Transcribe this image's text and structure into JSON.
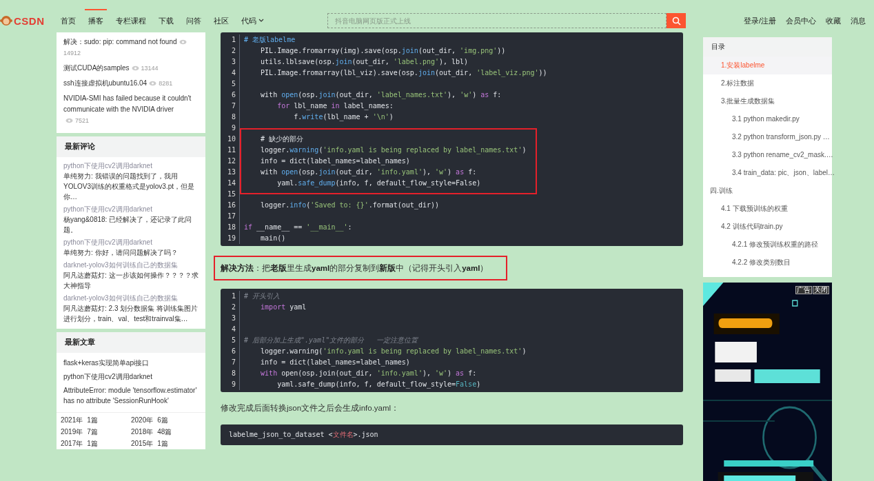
{
  "nav": {
    "logo": "CSDN",
    "items": [
      {
        "label": "首页",
        "selected": false,
        "has_menu": false
      },
      {
        "label": "播客",
        "selected": true,
        "has_menu": false
      },
      {
        "label": "专栏课程",
        "selected": false,
        "has_menu": false
      },
      {
        "label": "下载",
        "selected": false,
        "has_menu": false
      },
      {
        "label": "问答",
        "selected": false,
        "has_menu": false
      },
      {
        "label": "社区",
        "selected": false,
        "has_menu": false
      },
      {
        "label": "代码",
        "selected": false,
        "has_menu": true
      }
    ],
    "search": {
      "placeholder": "抖音电脑网页版正式上线"
    },
    "links": [
      "登录/注册",
      "会员中心",
      "收藏",
      "消息"
    ]
  },
  "sidebar": {
    "popular": [
      {
        "title": "解决：sudo: pip: command not found",
        "views": "14912"
      },
      {
        "title": "测试CUDA的samples",
        "views": "13144"
      },
      {
        "title": "ssh连接虚拟机ubuntu16.04",
        "views": "8281"
      },
      {
        "title": "NVIDIA-SMI has failed because it couldn't communicate with the NVIDIA driver",
        "views": "7521"
      }
    ],
    "comments": {
      "title": "最新评论",
      "items": [
        {
          "article": "python下使用cv2调用darknet",
          "text": "单纯努力: 我错误的问题找到了，我用YOLOV3训练的权重格式是yolov3.pt，但是你…"
        },
        {
          "article": "python下使用cv2调用darknet",
          "text": "杨yang&0818: 已经解决了，还记录了此问题。"
        },
        {
          "article": "python下使用cv2调用darknet",
          "text": "单纯努力: 你好，请问问题解决了吗？"
        },
        {
          "article": "darknet-yolov3如何训练自己的数据集",
          "text": "阿凡达蘑菇灯: 这一步该如何操作？？？？求大神指导"
        },
        {
          "article": "darknet-yolov3如何训练自己的数据集",
          "text": "阿凡达蘑菇灯: 2.3 划分数据集 将训练集图片进行划分，train、val、test和trainval集…"
        }
      ]
    },
    "articles": {
      "title": "最新文章",
      "items": [
        "flask+keras实现简单api接口",
        "python下使用cv2调用darknet",
        "AttributeError: module 'tensorflow.estimator' has no attribute 'SessionRunHook'"
      ],
      "archive": [
        {
          "year": "2021年",
          "count": "1篇"
        },
        {
          "year": "2020年",
          "count": "6篇"
        },
        {
          "year": "2019年",
          "count": "7篇"
        },
        {
          "year": "2018年",
          "count": "48篇"
        },
        {
          "year": "2017年",
          "count": "1篇"
        },
        {
          "year": "2015年",
          "count": "1篇"
        }
      ]
    }
  },
  "content": [
    {
      "kind": "code",
      "numbered": true,
      "segments": [
        {
          "boxed": false,
          "lines": [
            {
              "n": "1",
              "tokens": [
                {
                  "kind": "heading",
                  "t": "# 老版labelme"
                }
              ]
            },
            {
              "n": "2",
              "tokens": [
                {
                  "kind": "plain",
                  "t": "    PIL.Image.fromarray(img).save(osp."
                },
                {
                  "kind": "fn",
                  "t": "join"
                },
                {
                  "kind": "plain",
                  "t": "(out_dir, "
                },
                {
                  "kind": "str",
                  "t": "'img.png'"
                },
                {
                  "kind": "plain",
                  "t": "))"
                }
              ]
            },
            {
              "n": "3",
              "tokens": [
                {
                  "kind": "plain",
                  "t": "    utils.lblsave(osp."
                },
                {
                  "kind": "fn",
                  "t": "join"
                },
                {
                  "kind": "plain",
                  "t": "(out_dir, "
                },
                {
                  "kind": "str",
                  "t": "'label.png'"
                },
                {
                  "kind": "plain",
                  "t": "), lbl)"
                }
              ]
            },
            {
              "n": "4",
              "tokens": [
                {
                  "kind": "plain",
                  "t": "    PIL.Image.fromarray(lbl_viz).save(osp."
                },
                {
                  "kind": "fn",
                  "t": "join"
                },
                {
                  "kind": "plain",
                  "t": "(out_dir, "
                },
                {
                  "kind": "str",
                  "t": "'label_viz.png'"
                },
                {
                  "kind": "plain",
                  "t": "))"
                }
              ]
            },
            {
              "n": "5"
            },
            {
              "n": "6",
              "tokens": [
                {
                  "kind": "plain",
                  "t": "    with "
                },
                {
                  "kind": "fn",
                  "t": "open"
                },
                {
                  "kind": "plain",
                  "t": "(osp."
                },
                {
                  "kind": "fn",
                  "t": "join"
                },
                {
                  "kind": "plain",
                  "t": "(out_dir, "
                },
                {
                  "kind": "str",
                  "t": "'label_names.txt'"
                },
                {
                  "kind": "plain",
                  "t": "), "
                },
                {
                  "kind": "str",
                  "t": "'w'"
                },
                {
                  "kind": "plain",
                  "t": ") "
                },
                {
                  "kind": "kw",
                  "t": "as"
                },
                {
                  "kind": "plain",
                  "t": " f:"
                }
              ]
            },
            {
              "n": "7",
              "tokens": [
                {
                  "kind": "kw",
                  "t": "        for"
                },
                {
                  "kind": "plain",
                  "t": " lbl_name "
                },
                {
                  "kind": "kw",
                  "t": "in"
                },
                {
                  "kind": "plain",
                  "t": " label_names:"
                }
              ]
            },
            {
              "n": "8",
              "tokens": [
                {
                  "kind": "plain",
                  "t": "            f."
                },
                {
                  "kind": "fn",
                  "t": "write"
                },
                {
                  "kind": "plain",
                  "t": "(lbl_name + "
                },
                {
                  "kind": "str",
                  "t": "'\\n'"
                },
                {
                  "kind": "plain",
                  "t": ")"
                }
              ]
            },
            {
              "n": "9"
            }
          ]
        },
        {
          "boxed": true,
          "lines": [
            {
              "n": "10",
              "tokens": [
                {
                  "kind": "plain",
                  "t": "    # 缺少的部分"
                }
              ]
            },
            {
              "n": "11",
              "tokens": [
                {
                  "kind": "plain",
                  "t": "    logger."
                },
                {
                  "kind": "fn",
                  "t": "warning"
                },
                {
                  "kind": "plain",
                  "t": "("
                },
                {
                  "kind": "str",
                  "t": "'info.yaml is being replaced by label_names.txt'"
                },
                {
                  "kind": "plain",
                  "t": ")"
                }
              ]
            },
            {
              "n": "12",
              "tokens": [
                {
                  "kind": "plain",
                  "t": "    info = dict(label_names=label_names)"
                }
              ]
            },
            {
              "n": "13",
              "tokens": [
                {
                  "kind": "plain",
                  "t": "    with "
                },
                {
                  "kind": "fn",
                  "t": "open"
                },
                {
                  "kind": "plain",
                  "t": "(osp."
                },
                {
                  "kind": "fn",
                  "t": "join"
                },
                {
                  "kind": "plain",
                  "t": "(out_dir, "
                },
                {
                  "kind": "str",
                  "t": "'info.yaml'"
                },
                {
                  "kind": "plain",
                  "t": "), "
                },
                {
                  "kind": "str",
                  "t": "'w'"
                },
                {
                  "kind": "plain",
                  "t": ") "
                },
                {
                  "kind": "kw",
                  "t": "as"
                },
                {
                  "kind": "plain",
                  "t": " f:"
                }
              ]
            },
            {
              "n": "14",
              "tokens": [
                {
                  "kind": "plain",
                  "t": "        yaml."
                },
                {
                  "kind": "fn",
                  "t": "safe_dump"
                },
                {
                  "kind": "plain",
                  "t": "(info, f, default_flow_style=False)"
                }
              ]
            }
          ]
        },
        {
          "boxed": false,
          "lines": [
            {
              "n": "15"
            },
            {
              "n": "16",
              "tokens": [
                {
                  "kind": "plain",
                  "t": "    logger."
                },
                {
                  "kind": "fn",
                  "t": "info"
                },
                {
                  "kind": "plain",
                  "t": "("
                },
                {
                  "kind": "str",
                  "t": "'Saved to: {}'"
                },
                {
                  "kind": "plain",
                  "t": ".format(out_dir))"
                }
              ]
            },
            {
              "n": "17"
            },
            {
              "n": "18",
              "tokens": [
                {
                  "kind": "kw",
                  "t": "if"
                },
                {
                  "kind": "plain",
                  "t": " __name__ == "
                },
                {
                  "kind": "str",
                  "t": "'__main__'"
                },
                {
                  "kind": "plain",
                  "t": ":"
                }
              ]
            },
            {
              "n": "19",
              "tokens": [
                {
                  "kind": "plain",
                  "t": "    main()"
                }
              ]
            }
          ]
        }
      ]
    },
    {
      "kind": "paragraph",
      "boxed": true,
      "text": "**解决方法**：把**老版**里生成**yaml**的部分复制到**新版**中（记得开头引入**yaml**）"
    },
    {
      "kind": "code",
      "numbered": true,
      "segments": [
        {
          "boxed": false,
          "lines": [
            {
              "n": "1",
              "tokens": [
                {
                  "kind": "cmt",
                  "t": "# 开头引入"
                }
              ]
            },
            {
              "n": "2",
              "tokens": [
                {
                  "kind": "kw",
                  "t": "    import"
                },
                {
                  "kind": "plain",
                  "t": " yaml"
                }
              ]
            },
            {
              "n": "3"
            },
            {
              "n": "4"
            },
            {
              "n": "5",
              "tokens": [
                {
                  "kind": "cmt",
                  "t": "# 后部分加上生成\".yaml\"文件的部分   一定注意位置"
                }
              ]
            },
            {
              "n": "6",
              "tokens": [
                {
                  "kind": "plain",
                  "t": "    logger.warning("
                },
                {
                  "kind": "str",
                  "t": "'info.yaml is being replaced by label_names.txt'"
                },
                {
                  "kind": "plain",
                  "t": ")"
                }
              ]
            },
            {
              "n": "7",
              "tokens": [
                {
                  "kind": "plain",
                  "t": "    info = dict(label_names=label_names)"
                }
              ]
            },
            {
              "n": "8",
              "tokens": [
                {
                  "kind": "kw",
                  "t": "    with"
                },
                {
                  "kind": "plain",
                  "t": " open(osp.join(out_dir, "
                },
                {
                  "kind": "str",
                  "t": "'info.yaml'"
                },
                {
                  "kind": "plain",
                  "t": "), "
                },
                {
                  "kind": "str",
                  "t": "'w'"
                },
                {
                  "kind": "plain",
                  "t": ") "
                },
                {
                  "kind": "kw",
                  "t": "as"
                },
                {
                  "kind": "plain",
                  "t": " f:"
                }
              ]
            },
            {
              "n": "9",
              "tokens": [
                {
                  "kind": "plain",
                  "t": "        yaml.safe_dump(info, f, default_flow_style="
                },
                {
                  "kind": "const",
                  "t": "False"
                },
                {
                  "kind": "plain",
                  "t": ")"
                }
              ]
            }
          ]
        }
      ]
    },
    {
      "kind": "paragraph",
      "boxed": false,
      "text": "修改完成后面转换json文件之后会生成info.yaml："
    },
    {
      "kind": "code",
      "numbered": false,
      "segments": [
        {
          "boxed": false,
          "lines": [
            {
              "tokens": [
                {
                  "kind": "plain",
                  "t": "labelme_json_to_dataset <"
                },
                {
                  "kind": "tag",
                  "t": "文件名"
                },
                {
                  "kind": "plain",
                  "t": ">.json"
                }
              ]
            }
          ]
        }
      ]
    }
  ],
  "toc": {
    "title": "目录",
    "items": [
      {
        "children": [
          {
            "label": "1.安装labelme",
            "selected": true
          },
          {
            "label": "2.标注数据",
            "selected": false
          },
          {
            "label": "3.批量生成数据集",
            "selected": false,
            "children": [
              {
                "label": "3.1  python makedir.py",
                "selected": false
              },
              {
                "label": "3.2  python transform_json.py   …",
                "selected": false
              },
              {
                "label": "3.3  python rename_cv2_mask.…",
                "selected": false
              },
              {
                "label": "3.4 train_data:  pic、json、label…",
                "selected": false
              }
            ]
          }
        ]
      },
      {
        "label": "四.训练",
        "selected": false,
        "children": [
          {
            "label": "4.1 下载预训练的权重",
            "selected": false
          },
          {
            "label": "4.2 训练代码train.py",
            "selected": false,
            "children": [
              {
                "label": "4.2.1 修改预训练权重的路径",
                "selected": false
              },
              {
                "label": "4.2.2 修改类别数目",
                "selected": false
              }
            ]
          }
        ]
      }
    ]
  },
  "ad": {
    "kind": "picture",
    "tags": [
      "广告",
      "关闭"
    ]
  }
}
